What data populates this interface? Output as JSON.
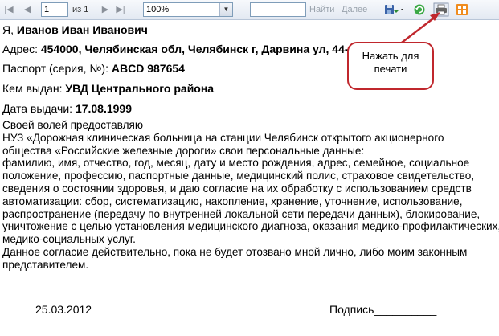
{
  "toolbar": {
    "page_number": "1",
    "page_of": "из 1",
    "zoom": "100%",
    "search_value": "",
    "find_label": "Найти",
    "separator": "|",
    "next_label": "Далее"
  },
  "document": {
    "name_prefix": "Я, ",
    "name_value": "Иванов Иван Иванович",
    "address_label": "Адрес: ",
    "address_value": "454000, Челябинская обл, Челябинск г, Дарвина ул, 44-5",
    "passport_label": "Паспорт (серия, №): ",
    "passport_value": "ABCD 987654",
    "issued_by_label": "Кем выдан: ",
    "issued_by_value": "УВД Центрального района",
    "issue_date_label": "Дата выдачи: ",
    "issue_date_value": "17.08.1999",
    "consent_lines": [
      "Своей волей предоставляю",
      "НУЗ «Дорожная клиническая больница на станции Челябинск открытого акционерного",
      "общества «Российские железные дороги» свои персональные данные:",
      "фамилию, имя, отчество, год, месяц, дату и место рождения, адрес, семейное, социальное",
      "положение, профессию, паспортные данные, медицинский полис, страховое свидетельство,",
      "сведения о состоянии здоровья, и даю согласие на их обработку с использованием средств",
      "автоматизации: сбор, систематизацию, накопление, хранение, уточнение, использование,",
      "распространение (передачу по внутренней локальной сети передачи данных), блокирование,",
      "уничтожение с целью установления медицинского диагноза, оказания медико-профилактических,",
      "медико-социальных услуг.",
      "Данное согласие действительно, пока не будет отозвано мной лично, либо моим законным",
      "представителем."
    ],
    "date": "25.03.2012",
    "signature": "Подпись__________"
  },
  "annotation": {
    "line1": "Нажать для",
    "line2": "печати",
    "color": "#c0272d"
  }
}
